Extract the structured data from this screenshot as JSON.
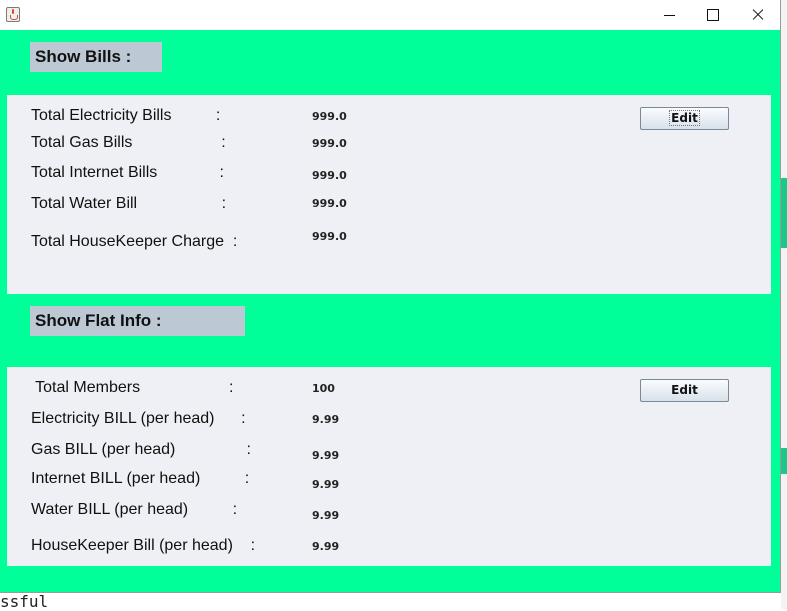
{
  "background": {
    "terminal_fragment": "ssful"
  },
  "window": {
    "title": "",
    "controls": [
      "minimize-icon",
      "maximize-icon",
      "close-icon"
    ]
  },
  "colors": {
    "content_bg": "#00ff99",
    "panel_bg": "#eef0f5",
    "header_bg": "#bcc8d4"
  },
  "bills": {
    "header": "Show Bills  :",
    "edit_label": "Edit",
    "rows": [
      {
        "label": "Total Electricity Bills          :",
        "value": "999.0"
      },
      {
        "label": "Total Gas Bills                    :",
        "value": "999.0"
      },
      {
        "label": "Total Internet Bills              :",
        "value": "999.0"
      },
      {
        "label": "Total Water Bill                   :",
        "value": "999.0"
      },
      {
        "label": "Total HouseKeeper Charge  :",
        "value": "999.0"
      }
    ]
  },
  "flat": {
    "header": "Show Flat Info  :",
    "edit_label": "Edit",
    "rows": [
      {
        "label": " Total Members                    :",
        "value": "100"
      },
      {
        "label": "Electricity BILL (per head)      :",
        "value": "9.99"
      },
      {
        "label": "Gas BILL (per head)                :",
        "value": "9.99"
      },
      {
        "label": "Internet BILL (per head)          :",
        "value": "9.99"
      },
      {
        "label": "Water BILL (per head)          :",
        "value": "9.99"
      },
      {
        "label": "HouseKeeper Bill (per head)    :",
        "value": "9.99"
      }
    ]
  }
}
